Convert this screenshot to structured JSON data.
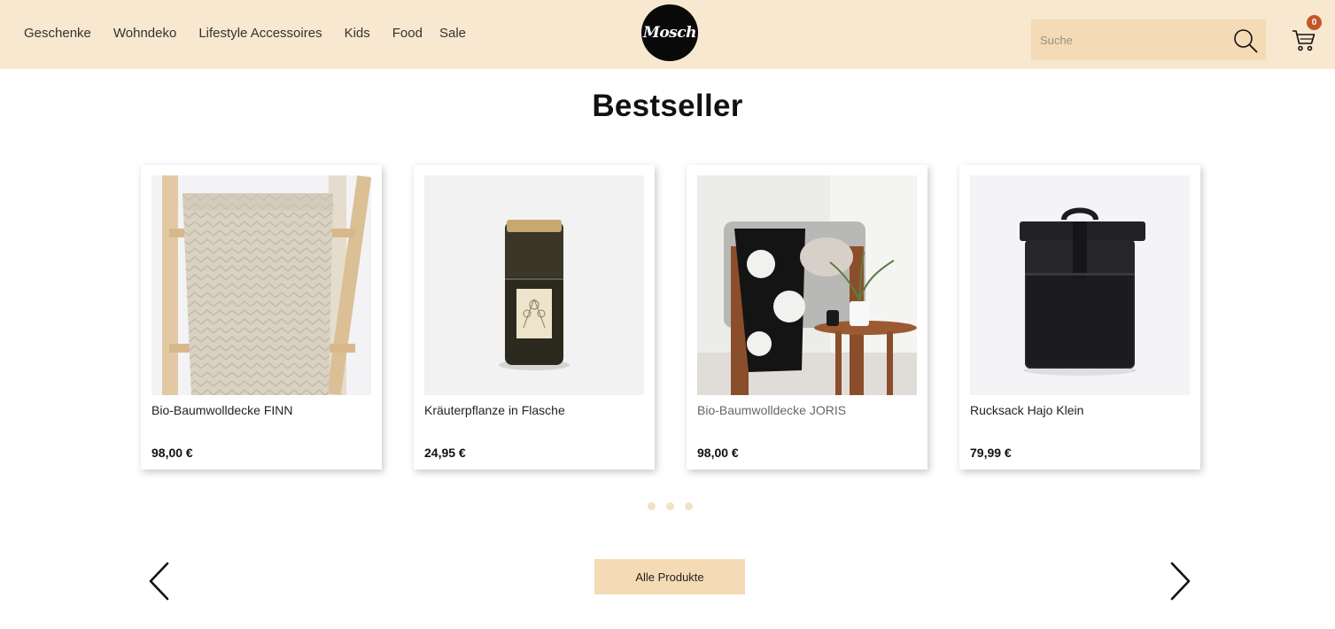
{
  "nav": {
    "items": [
      {
        "label": "Geschenke"
      },
      {
        "label": "Wohndeko"
      },
      {
        "label": "Lifestyle Accessoires"
      },
      {
        "label": "Kids"
      },
      {
        "label": "Food"
      },
      {
        "label": "Sale"
      }
    ]
  },
  "logo": {
    "text": "Mosch"
  },
  "search": {
    "placeholder": "Suche",
    "icon": "magnifier-icon"
  },
  "cart": {
    "count": "0",
    "icon": "shopping-cart-icon"
  },
  "section": {
    "title": "Bestseller"
  },
  "products": [
    {
      "name": "Bio-Baumwolldecke FINN",
      "price": "98,00 €",
      "image": "herringbone-blanket-on-ladder"
    },
    {
      "name": "Kräuterpflanze in Flasche",
      "price": "24,95 €",
      "image": "herb-plant-in-bottle"
    },
    {
      "name": "Bio-Baumwolldecke JORIS",
      "price": "98,00 €",
      "image": "black-white-blanket-on-chair"
    },
    {
      "name": "Rucksack Hajo Klein",
      "price": "79,99 €",
      "image": "black-backpack"
    }
  ],
  "carousel": {
    "pages": 3,
    "prev_icon": "chevron-left-icon",
    "next_icon": "chevron-right-icon"
  },
  "cta": {
    "label": "Alle Produkte"
  },
  "colors": {
    "header_bg": "#f8e8d0",
    "accent": "#f4dbb5",
    "badge": "#c0572b"
  }
}
